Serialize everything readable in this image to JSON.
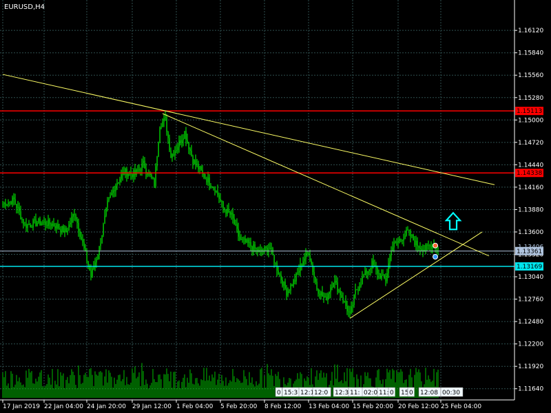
{
  "chart_data": {
    "type": "candlestick",
    "symbol": "EURUSD,H4",
    "colors": {
      "background": "#000000",
      "grid": "#2f4f4f",
      "candles": "#00ff00",
      "volume": "#00c000",
      "trendline": "#ffff66",
      "red_level": "#ff0000",
      "cyan_level": "#00e5ee",
      "ask_level": "#b0c4de",
      "arrow": "#00ffff",
      "text": "#ffffff"
    },
    "ylim": [
      1.115,
      1.165
    ],
    "xlim": [
      0,
      372
    ],
    "y_ticks": [
      {
        "value": 1.1612,
        "label": "1.16120"
      },
      {
        "value": 1.1584,
        "label": "1.15840"
      },
      {
        "value": 1.1556,
        "label": "1.15560"
      },
      {
        "value": 1.1528,
        "label": "1.15280"
      },
      {
        "value": 1.15,
        "label": "1.15000"
      },
      {
        "value": 1.1472,
        "label": "1.14720"
      },
      {
        "value": 1.1444,
        "label": "1.14440"
      },
      {
        "value": 1.1416,
        "label": "1.14160"
      },
      {
        "value": 1.1388,
        "label": "1.13880"
      },
      {
        "value": 1.136,
        "label": "1.13600"
      },
      {
        "value": 1.1332,
        "label": "1.13320"
      },
      {
        "value": 1.1304,
        "label": "1.13040"
      },
      {
        "value": 1.1276,
        "label": "1.12760"
      },
      {
        "value": 1.1248,
        "label": "1.12480"
      },
      {
        "value": 1.122,
        "label": "1.12200"
      },
      {
        "value": 1.1192,
        "label": "1.11920"
      },
      {
        "value": 1.1164,
        "label": "1.11640"
      }
    ],
    "x_ticks": [
      {
        "bar": 0,
        "label": "17 Jan 2019"
      },
      {
        "bar": 30,
        "label": "22 Jan 04:00"
      },
      {
        "bar": 61,
        "label": "24 Jan 20:00"
      },
      {
        "bar": 94,
        "label": "29 Jan 12:00"
      },
      {
        "bar": 126,
        "label": "1 Feb 04:00"
      },
      {
        "bar": 158,
        "label": "5 Feb 20:00"
      },
      {
        "bar": 190,
        "label": "8 Feb 12:00"
      },
      {
        "bar": 222,
        "label": "13 Feb 04:00"
      },
      {
        "bar": 254,
        "label": "15 Feb 20:00"
      },
      {
        "bar": 287,
        "label": "20 Feb 12:00"
      },
      {
        "bar": 318,
        "label": "25 Feb 04:00"
      }
    ],
    "h_levels": [
      {
        "price": 1.15113,
        "label": "1.15113",
        "kind": "red"
      },
      {
        "price": 1.14338,
        "label": "1.14338",
        "kind": "red"
      },
      {
        "price": 1.13361,
        "label": "1.13361",
        "kind": "ask"
      },
      {
        "price": 1.13169,
        "label": "1.13169",
        "kind": "cyan"
      }
    ],
    "bid_label": "1.13406",
    "trendlines": [
      {
        "x1": 0,
        "y1": 1.1557,
        "x2": 357,
        "y2": 1.1419
      },
      {
        "x1": 116,
        "y1": 1.1508,
        "x2": 353,
        "y2": 1.133
      },
      {
        "x1": 252,
        "y1": 1.1252,
        "x2": 348,
        "y2": 1.136
      }
    ],
    "arrow": {
      "bar": 327,
      "price": 1.1358,
      "direction": "up"
    },
    "markers": [
      {
        "bar": 314,
        "price": 1.1343,
        "color": "#ff6633"
      },
      {
        "bar": 314,
        "price": 1.1329,
        "color": "#3399ff"
      }
    ],
    "overlay_labels": [
      {
        "bar": 199,
        "text": "0"
      },
      {
        "bar": 204,
        "text": "15:3"
      },
      {
        "bar": 216,
        "text": "12:16"
      },
      {
        "bar": 226,
        "text": "12:0"
      },
      {
        "bar": 241,
        "text": "12:3"
      },
      {
        "bar": 252,
        "text": "11:"
      },
      {
        "bar": 262,
        "text": "02:01"
      },
      {
        "bar": 273,
        "text": "11:"
      },
      {
        "bar": 281,
        "text": "0"
      },
      {
        "bar": 289,
        "text": "15:"
      },
      {
        "bar": 295,
        "text": "0"
      },
      {
        "bar": 303,
        "text": "12:08"
      },
      {
        "bar": 319,
        "text": "00:30"
      }
    ],
    "anchors": [
      {
        "bar": 0,
        "price": 1.1395
      },
      {
        "bar": 8,
        "price": 1.14
      },
      {
        "bar": 16,
        "price": 1.1368
      },
      {
        "bar": 26,
        "price": 1.1372
      },
      {
        "bar": 36,
        "price": 1.137
      },
      {
        "bar": 46,
        "price": 1.136
      },
      {
        "bar": 52,
        "price": 1.1385
      },
      {
        "bar": 58,
        "price": 1.1345
      },
      {
        "bar": 64,
        "price": 1.1305
      },
      {
        "bar": 70,
        "price": 1.134
      },
      {
        "bar": 76,
        "price": 1.1395
      },
      {
        "bar": 82,
        "price": 1.142
      },
      {
        "bar": 88,
        "price": 1.1435
      },
      {
        "bar": 96,
        "price": 1.1432
      },
      {
        "bar": 102,
        "price": 1.1445
      },
      {
        "bar": 110,
        "price": 1.142
      },
      {
        "bar": 114,
        "price": 1.1495
      },
      {
        "bar": 118,
        "price": 1.15
      },
      {
        "bar": 122,
        "price": 1.1455
      },
      {
        "bar": 126,
        "price": 1.1465
      },
      {
        "bar": 132,
        "price": 1.1485
      },
      {
        "bar": 138,
        "price": 1.145
      },
      {
        "bar": 146,
        "price": 1.143
      },
      {
        "bar": 154,
        "price": 1.1415
      },
      {
        "bar": 160,
        "price": 1.139
      },
      {
        "bar": 166,
        "price": 1.138
      },
      {
        "bar": 172,
        "price": 1.135
      },
      {
        "bar": 178,
        "price": 1.1345
      },
      {
        "bar": 186,
        "price": 1.1335
      },
      {
        "bar": 194,
        "price": 1.134
      },
      {
        "bar": 200,
        "price": 1.131
      },
      {
        "bar": 206,
        "price": 1.1285
      },
      {
        "bar": 212,
        "price": 1.13
      },
      {
        "bar": 218,
        "price": 1.1325
      },
      {
        "bar": 222,
        "price": 1.1335
      },
      {
        "bar": 228,
        "price": 1.129
      },
      {
        "bar": 234,
        "price": 1.1275
      },
      {
        "bar": 240,
        "price": 1.13
      },
      {
        "bar": 246,
        "price": 1.128
      },
      {
        "bar": 252,
        "price": 1.1255
      },
      {
        "bar": 256,
        "price": 1.1285
      },
      {
        "bar": 262,
        "price": 1.1305
      },
      {
        "bar": 268,
        "price": 1.132
      },
      {
        "bar": 274,
        "price": 1.1305
      },
      {
        "bar": 278,
        "price": 1.13
      },
      {
        "bar": 282,
        "price": 1.134
      },
      {
        "bar": 288,
        "price": 1.135
      },
      {
        "bar": 294,
        "price": 1.136
      },
      {
        "bar": 300,
        "price": 1.1345
      },
      {
        "bar": 306,
        "price": 1.1338
      },
      {
        "bar": 312,
        "price": 1.1345
      },
      {
        "bar": 316,
        "price": 1.1341
      }
    ],
    "volume_max": 100
  }
}
